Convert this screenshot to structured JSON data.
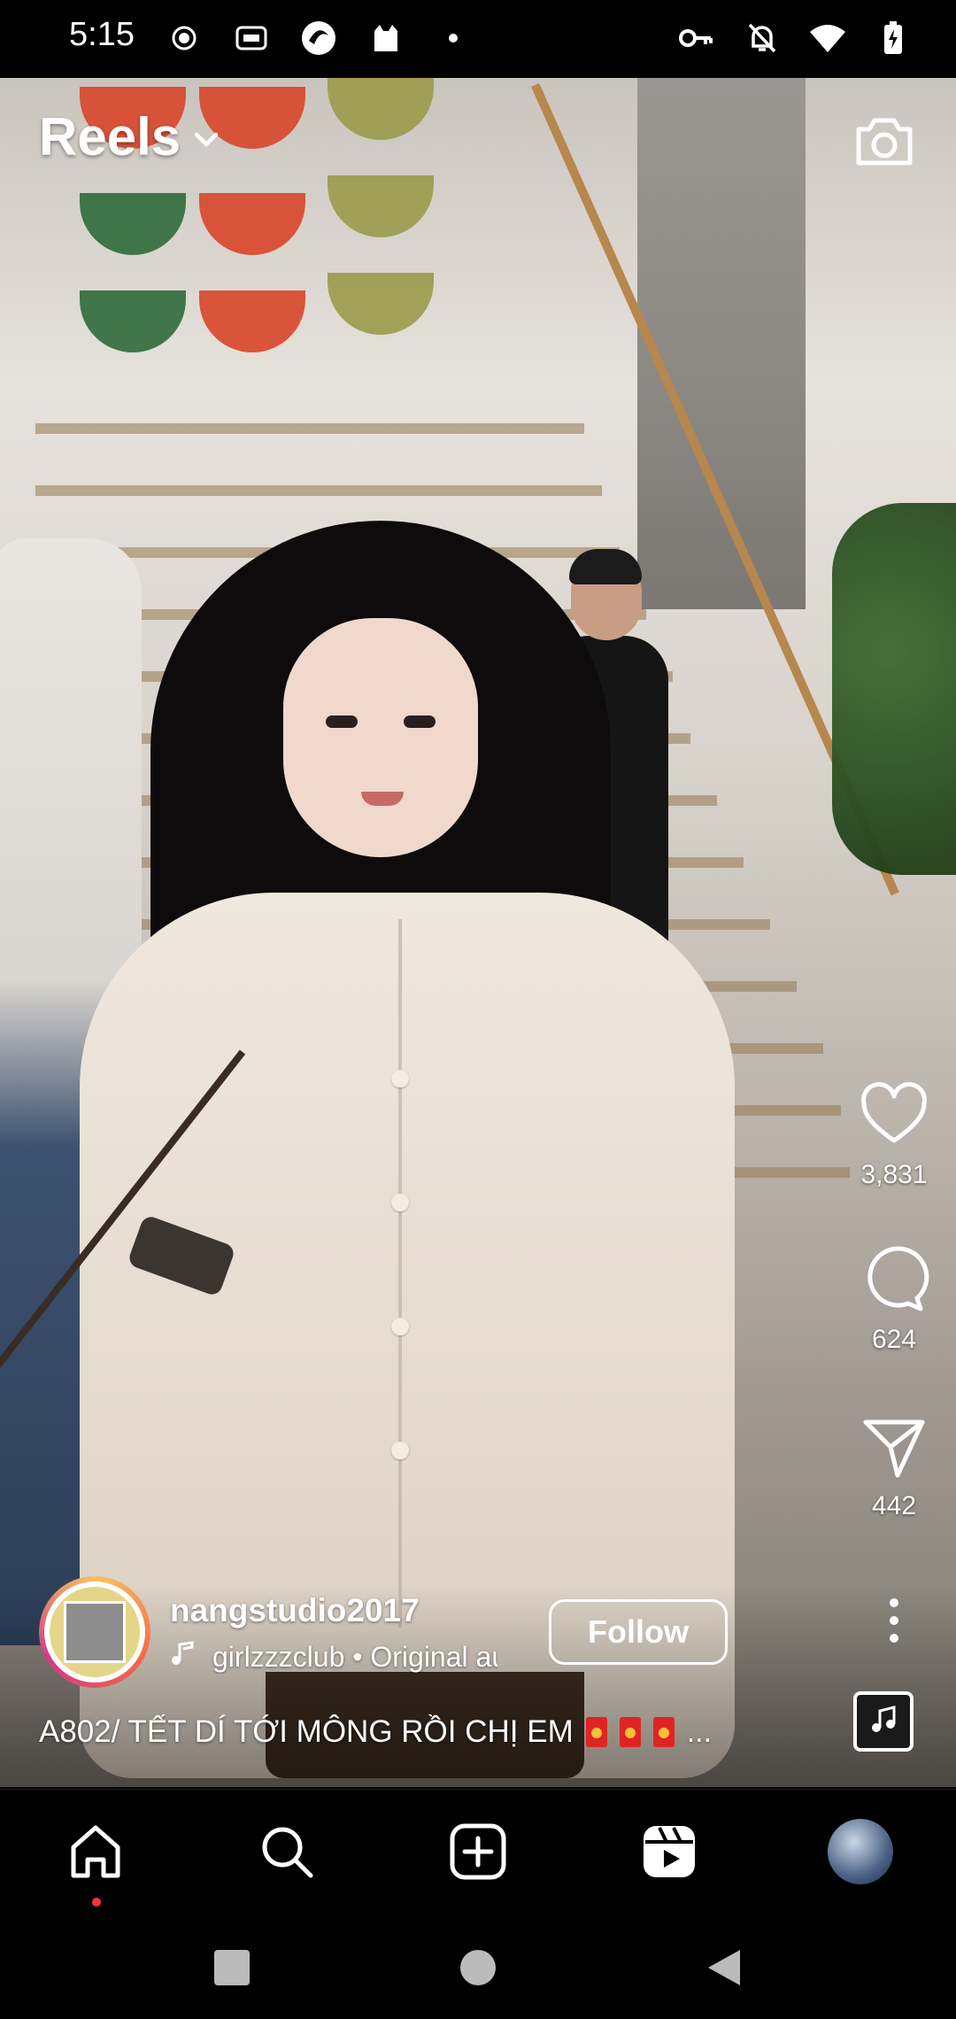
{
  "status_bar": {
    "time": "5:15",
    "left_icons": [
      "record-icon",
      "iqiyi-icon",
      "app-swirl-icon",
      "cat-icon",
      "dot-icon"
    ],
    "right_icons": [
      "key-icon",
      "notifications-off-icon",
      "wifi-icon",
      "battery-charging-icon"
    ]
  },
  "header": {
    "title": "Reels",
    "camera_icon": "camera-icon"
  },
  "actions": {
    "likes": "3,831",
    "comments": "624",
    "shares": "442"
  },
  "author": {
    "username": "nangstudio2017",
    "audio": "girlzzzclub • Original audio",
    "follow_label": "Follow"
  },
  "caption": {
    "text": "A802/ TẾT DÍ TỚI MÔNG RỒI CHỊ EM",
    "more": "..."
  },
  "tab_bar": {
    "items": [
      "home-icon",
      "search-icon",
      "create-icon",
      "reels-icon",
      "profile-avatar"
    ]
  },
  "system_nav": [
    "recents-button",
    "home-button",
    "back-button"
  ],
  "colors": {
    "background": "#000000",
    "text": "#ffffff",
    "notification_dot": "#ff3040"
  }
}
